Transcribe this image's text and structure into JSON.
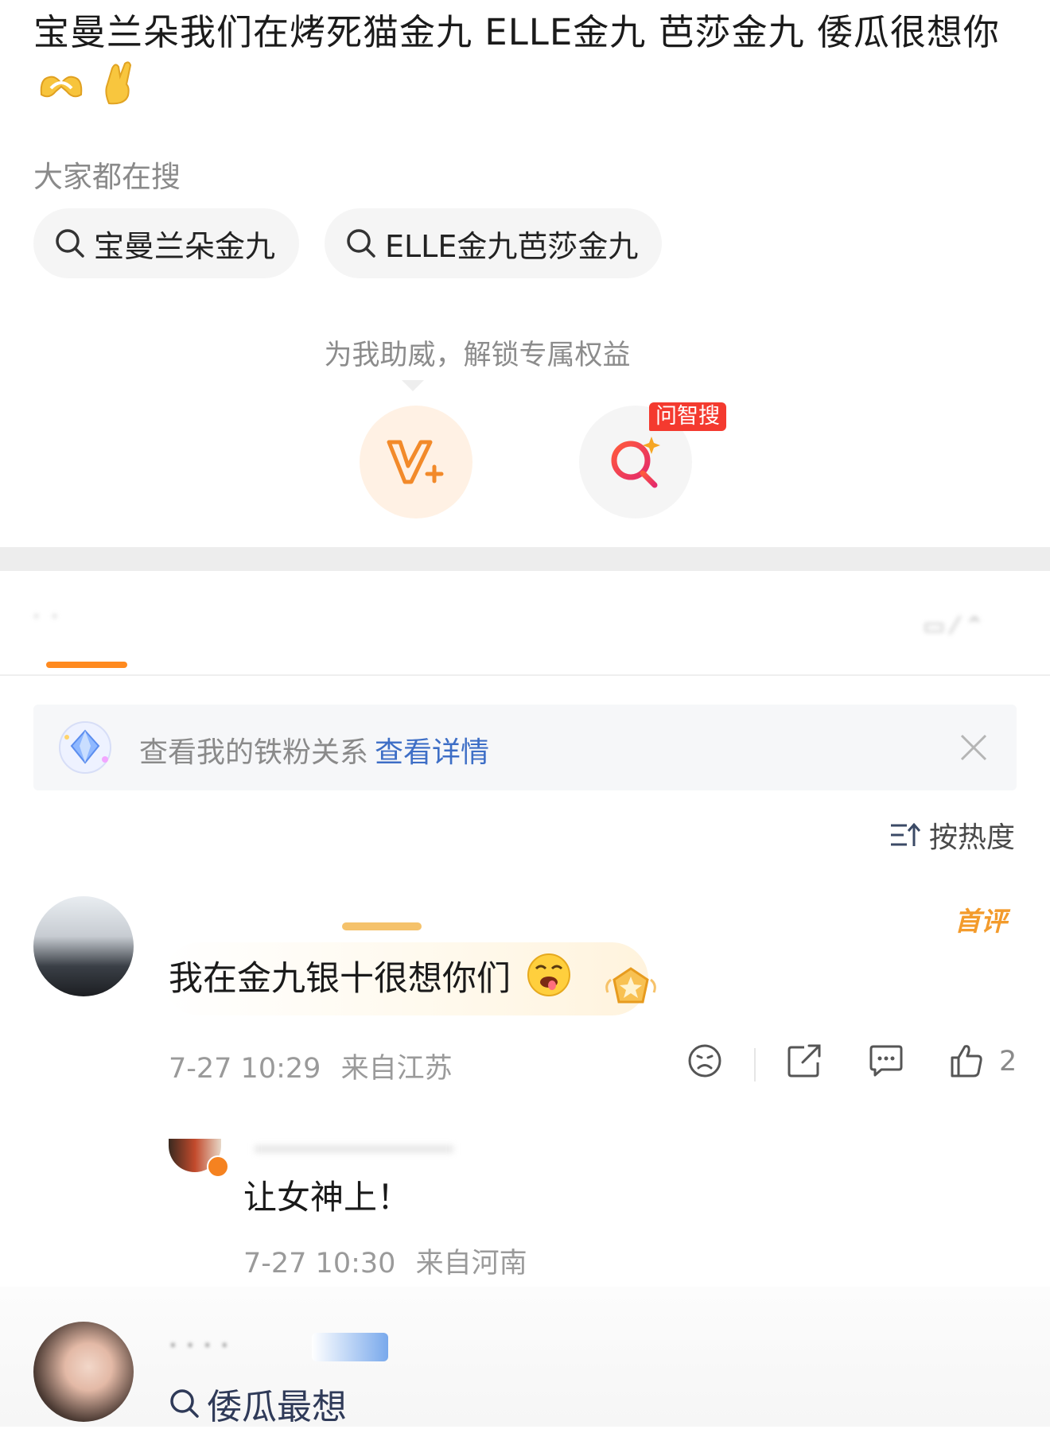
{
  "post": {
    "text": "宝曼兰朵我们在烤死猫金九 ELLE金九 芭莎金九 倭瓜很想你",
    "emojis": [
      "heart-hands-emoji",
      "crossed-fingers-emoji"
    ]
  },
  "search_section": {
    "title": "大家都在搜",
    "chips": [
      "宝曼兰朵金九",
      "ELLE金九芭莎金九"
    ]
  },
  "support": {
    "label": "为我助威，解锁专属权益",
    "ask_badge": "问智搜"
  },
  "fan_banner": {
    "text": "查看我的铁粉关系",
    "link": "查看详情"
  },
  "sort": {
    "label": "按热度"
  },
  "comments": [
    {
      "badge": "首评",
      "text": "我在金九银十很想你们",
      "time": "7-27 10:29",
      "location": "来自江苏",
      "likes": "2",
      "reply": {
        "text": "让女神上！",
        "time": "7-27 10:30",
        "location": "来自河南"
      }
    }
  ],
  "next_comment": {
    "search_text": "倭瓜最想"
  },
  "colors": {
    "accent_orange": "#ff8a1f",
    "link_blue": "#3d6ec6",
    "badge_red": "#f43a2f",
    "muted": "#9a9a9a"
  }
}
